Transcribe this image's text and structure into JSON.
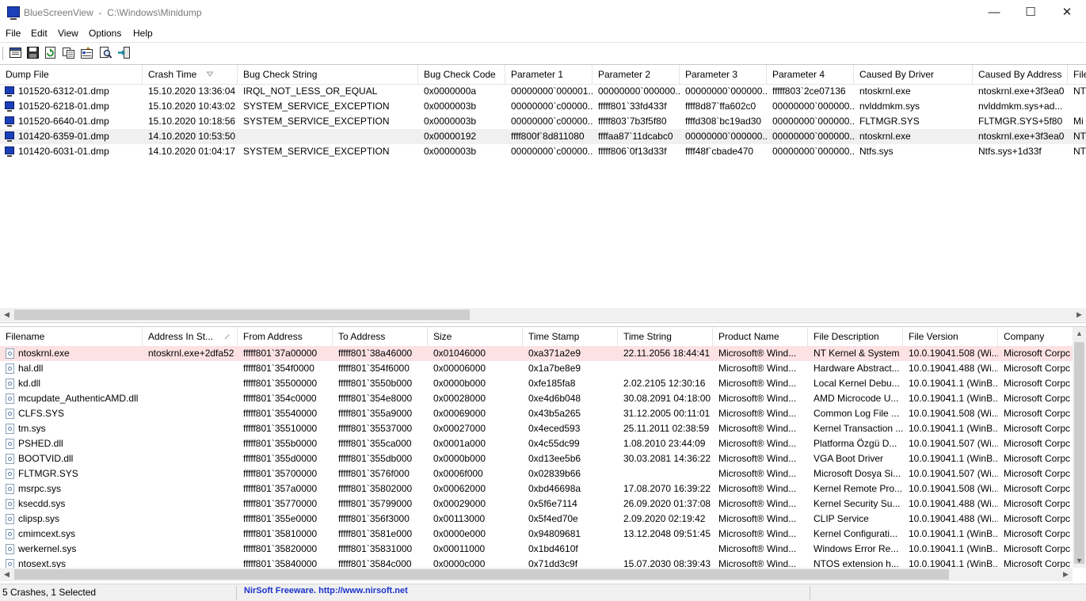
{
  "window": {
    "app_name": "BlueScreenView",
    "path": "C:\\Windows\\Minidump",
    "minimize_glyph": "—",
    "maximize_glyph": "☐",
    "close_glyph": "✕"
  },
  "menu": [
    "File",
    "Edit",
    "View",
    "Options",
    "Help"
  ],
  "toolbar": {
    "icons": [
      "html-report-icon",
      "save-icon",
      "refresh-icon",
      "copy-icon",
      "properties-icon",
      "find-icon",
      "exit-icon"
    ]
  },
  "top_table": {
    "columns": [
      "Dump File",
      "Crash Time",
      "Bug Check String",
      "Bug Check Code",
      "Parameter 1",
      "Parameter 2",
      "Parameter 3",
      "Parameter 4",
      "Caused By Driver",
      "Caused By Address",
      "File"
    ],
    "rows": [
      [
        "101520-6312-01.dmp",
        "15.10.2020 13:36:04",
        "IRQL_NOT_LESS_OR_EQUAL",
        "0x0000000a",
        "00000000`000001...",
        "00000000`000000...",
        "00000000`000000...",
        "fffff803`2ce07136",
        "ntoskrnl.exe",
        "ntoskrnl.exe+3f3ea0",
        "NT"
      ],
      [
        "101520-6218-01.dmp",
        "15.10.2020 10:43:02",
        "SYSTEM_SERVICE_EXCEPTION",
        "0x0000003b",
        "00000000`c00000...",
        "fffff801`33fd433f",
        "ffff8d87`ffa602c0",
        "00000000`000000...",
        "nvlddmkm.sys",
        "nvlddmkm.sys+ad...",
        ""
      ],
      [
        "101520-6640-01.dmp",
        "15.10.2020 10:18:56",
        "SYSTEM_SERVICE_EXCEPTION",
        "0x0000003b",
        "00000000`c00000...",
        "fffff803`7b3f5f80",
        "ffffd308`bc19ad30",
        "00000000`000000...",
        "FLTMGR.SYS",
        "FLTMGR.SYS+5f80",
        "Mi"
      ],
      [
        "101420-6359-01.dmp",
        "14.10.2020 10:53:50",
        "",
        "0x00000192",
        "ffff800f`8d811080",
        "ffffaa87`11dcabc0",
        "00000000`000000...",
        "00000000`000000...",
        "ntoskrnl.exe",
        "ntoskrnl.exe+3f3ea0",
        "NT"
      ],
      [
        "101420-6031-01.dmp",
        "14.10.2020 01:04:17",
        "SYSTEM_SERVICE_EXCEPTION",
        "0x0000003b",
        "00000000`c00000...",
        "fffff806`0f13d33f",
        "ffff48f`cbade470",
        "00000000`000000...",
        "Ntfs.sys",
        "Ntfs.sys+1d33f",
        "NT"
      ]
    ]
  },
  "bottom_table": {
    "columns": [
      "Filename",
      "Address In St...",
      "From Address",
      "To Address",
      "Size",
      "Time Stamp",
      "Time String",
      "Product Name",
      "File Description",
      "File Version",
      "Company"
    ],
    "rows": [
      [
        "ntoskrnl.exe",
        "ntoskrnl.exe+2dfa52",
        "fffff801`37a00000",
        "fffff801`38a46000",
        "0x01046000",
        "0xa371a2e9",
        "22.11.2056 18:44:41",
        "Microsoft® Wind...",
        "NT Kernel & System",
        "10.0.19041.508 (Wi...",
        "Microsoft Corpc"
      ],
      [
        "hal.dll",
        "",
        "fffff801`354f0000",
        "fffff801`354f6000",
        "0x00006000",
        "0x1a7be8e9",
        "",
        "Microsoft® Wind...",
        "Hardware Abstract...",
        "10.0.19041.488 (Wi...",
        "Microsoft Corpc"
      ],
      [
        "kd.dll",
        "",
        "fffff801`35500000",
        "fffff801`3550b000",
        "0x0000b000",
        "0xfe185fa8",
        "2.02.2105 12:30:16",
        "Microsoft® Wind...",
        "Local Kernel Debu...",
        "10.0.19041.1 (WinB...",
        "Microsoft Corpc"
      ],
      [
        "mcupdate_AuthenticAMD.dll",
        "",
        "fffff801`354c0000",
        "fffff801`354e8000",
        "0x00028000",
        "0xe4d6b048",
        "30.08.2091 04:18:00",
        "Microsoft® Wind...",
        "AMD Microcode U...",
        "10.0.19041.1 (WinB...",
        "Microsoft Corpc"
      ],
      [
        "CLFS.SYS",
        "",
        "fffff801`35540000",
        "fffff801`355a9000",
        "0x00069000",
        "0x43b5a265",
        "31.12.2005 00:11:01",
        "Microsoft® Wind...",
        "Common Log File ...",
        "10.0.19041.508 (Wi...",
        "Microsoft Corpc"
      ],
      [
        "tm.sys",
        "",
        "fffff801`35510000",
        "fffff801`35537000",
        "0x00027000",
        "0x4eced593",
        "25.11.2011 02:38:59",
        "Microsoft® Wind...",
        "Kernel Transaction ...",
        "10.0.19041.1 (WinB...",
        "Microsoft Corpc"
      ],
      [
        "PSHED.dll",
        "",
        "fffff801`355b0000",
        "fffff801`355ca000",
        "0x0001a000",
        "0x4c55dc99",
        "1.08.2010 23:44:09",
        "Microsoft® Wind...",
        "Platforma Özgü D...",
        "10.0.19041.507 (Wi...",
        "Microsoft Corpc"
      ],
      [
        "BOOTVID.dll",
        "",
        "fffff801`355d0000",
        "fffff801`355db000",
        "0x0000b000",
        "0xd13ee5b6",
        "30.03.2081 14:36:22",
        "Microsoft® Wind...",
        "VGA Boot Driver",
        "10.0.19041.1 (WinB...",
        "Microsoft Corpc"
      ],
      [
        "FLTMGR.SYS",
        "",
        "fffff801`35700000",
        "fffff801`3576f000",
        "0x0006f000",
        "0x02839b66",
        "",
        "Microsoft® Wind...",
        "Microsoft Dosya Si...",
        "10.0.19041.507 (Wi...",
        "Microsoft Corpc"
      ],
      [
        "msrpc.sys",
        "",
        "fffff801`357a0000",
        "fffff801`35802000",
        "0x00062000",
        "0xbd46698a",
        "17.08.2070 16:39:22",
        "Microsoft® Wind...",
        "Kernel Remote Pro...",
        "10.0.19041.508 (Wi...",
        "Microsoft Corpc"
      ],
      [
        "ksecdd.sys",
        "",
        "fffff801`35770000",
        "fffff801`35799000",
        "0x00029000",
        "0x5f6e7114",
        "26.09.2020 01:37:08",
        "Microsoft® Wind...",
        "Kernel Security Su...",
        "10.0.19041.488 (Wi...",
        "Microsoft Corpc"
      ],
      [
        "clipsp.sys",
        "",
        "fffff801`355e0000",
        "fffff801`356f3000",
        "0x00113000",
        "0x5f4ed70e",
        "2.09.2020 02:19:42",
        "Microsoft® Wind...",
        "CLIP Service",
        "10.0.19041.488 (Wi...",
        "Microsoft Corpc"
      ],
      [
        "cmimcext.sys",
        "",
        "fffff801`35810000",
        "fffff801`3581e000",
        "0x0000e000",
        "0x94809681",
        "13.12.2048 09:51:45",
        "Microsoft® Wind...",
        "Kernel Configurati...",
        "10.0.19041.1 (WinB...",
        "Microsoft Corpc"
      ],
      [
        "werkernel.sys",
        "",
        "fffff801`35820000",
        "fffff801`35831000",
        "0x00011000",
        "0x1bd4610f",
        "",
        "Microsoft® Wind...",
        "Windows Error Re...",
        "10.0.19041.1 (WinB...",
        "Microsoft Corpc"
      ],
      [
        "ntosext.sys",
        "",
        "fffff801`35840000",
        "fffff801`3584c000",
        "0x0000c000",
        "0x71dd3c9f",
        "15.07.2030 08:39:43",
        "Microsoft® Wind...",
        "NTOS extension h...",
        "10.0.19041.1 (WinB...",
        "Microsoft Corpc"
      ]
    ]
  },
  "status": {
    "summary": "5 Crashes, 1 Selected",
    "link": "NirSoft Freeware.  http://www.nirsoft.net"
  }
}
